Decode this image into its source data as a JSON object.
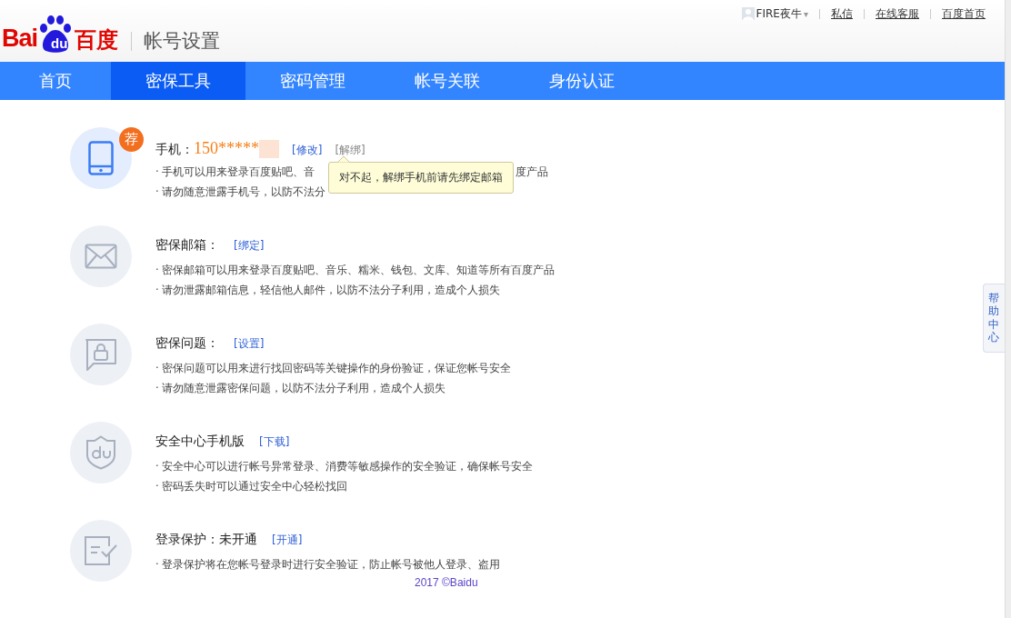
{
  "header": {
    "logo_latin_left": "Bai",
    "logo_badge": "du",
    "logo_chinese": "百度",
    "page_title": "帐号设置",
    "user": {
      "name": "FIRE夜牛",
      "menu_caret": "▾"
    },
    "links": [
      "私信",
      "在线客服",
      "百度首页"
    ]
  },
  "tabs": [
    {
      "label": "首页",
      "selected": false
    },
    {
      "label": "密保工具",
      "selected": true
    },
    {
      "label": "密码管理",
      "selected": false
    },
    {
      "label": "帐号关联",
      "selected": false
    },
    {
      "label": "身份认证",
      "selected": false
    }
  ],
  "sections": [
    {
      "kind": "phone",
      "title": "手机：",
      "value": "150*****",
      "recommended_badge": "荐",
      "actions": [
        {
          "label": "[修改]",
          "disabled": false
        },
        {
          "label": "[解绑]",
          "disabled": true
        }
      ],
      "lines": [
        {
          "text": "· 手机可以用来登录百度贴吧、音",
          "tail": "度产品"
        },
        {
          "text": "· 请勿随意泄露手机号，以防不法分"
        }
      ],
      "tooltip": "对不起，解绑手机前请先绑定邮箱"
    },
    {
      "kind": "mail",
      "title": "密保邮箱：",
      "actions": [
        {
          "label": "[绑定]",
          "disabled": false
        }
      ],
      "lines": [
        {
          "text": "· 密保邮箱可以用来登录百度贴吧、音乐、糯米、钱包、文库、知道等所有百度产品"
        },
        {
          "text": "· 请勿泄露邮箱信息，轻信他人邮件，以防不法分子利用，造成个人损失"
        }
      ]
    },
    {
      "kind": "question",
      "title": "密保问题：",
      "actions": [
        {
          "label": "[设置]",
          "disabled": false
        }
      ],
      "lines": [
        {
          "text": "· 密保问题可以用来进行找回密码等关键操作的身份验证，保证您帐号安全"
        },
        {
          "text": "· 请勿随意泄露密保问题，以防不法分子利用，造成个人损失"
        }
      ]
    },
    {
      "kind": "shield",
      "title": "安全中心手机版",
      "actions": [
        {
          "label": "[下载]",
          "disabled": false
        }
      ],
      "lines": [
        {
          "text": "· 安全中心可以进行帐号异常登录、消费等敏感操作的安全验证，确保帐号安全"
        },
        {
          "text": "· 密码丢失时可以通过安全中心轻松找回"
        }
      ]
    },
    {
      "kind": "login",
      "title": "登录保护：未开通",
      "actions": [
        {
          "label": "[开通]",
          "disabled": false
        }
      ],
      "lines": [
        {
          "text": "· 登录保护将在您帐号登录时进行安全验证，防止帐号被他人登录、盗用"
        }
      ]
    }
  ],
  "footer": "2017 ©Baidu",
  "help_tab": "帮助中心"
}
